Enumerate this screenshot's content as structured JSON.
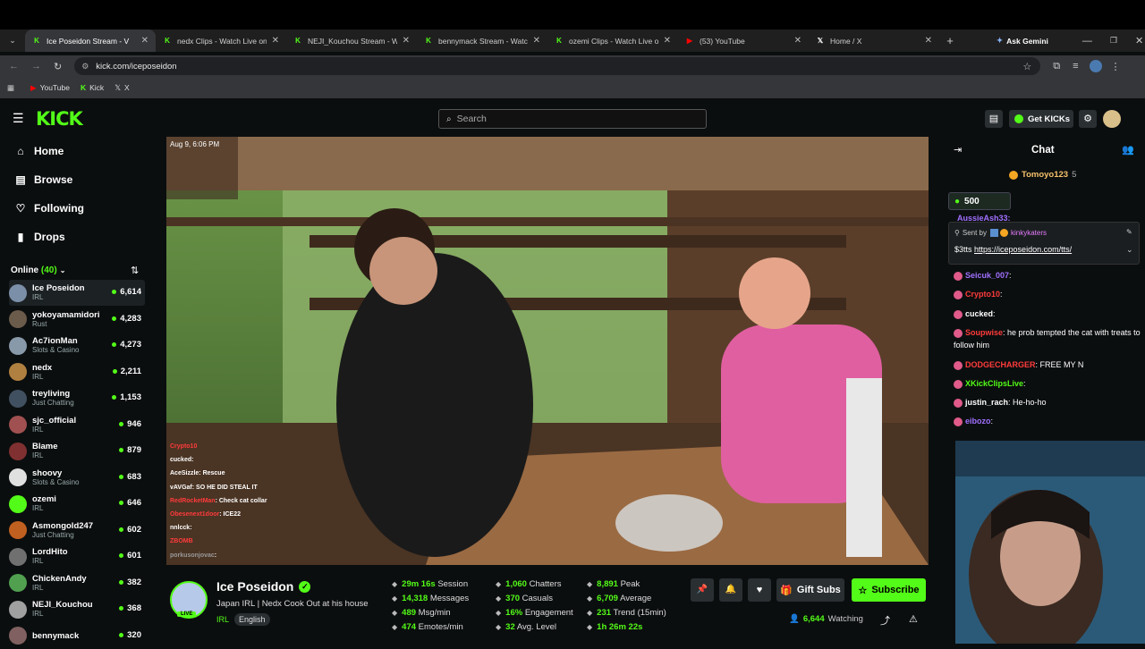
{
  "browser": {
    "tabs": [
      {
        "title": "Ice Poseidon Stream - V",
        "active": true,
        "icon": "kick-icon"
      },
      {
        "title": "nedx Clips - Watch Live on",
        "active": false,
        "icon": "kick-icon"
      },
      {
        "title": "NEJI_Kouchou Stream - Wat",
        "active": false,
        "icon": "kick-icon"
      },
      {
        "title": "bennymack Stream - Watch",
        "active": false,
        "icon": "kick-icon"
      },
      {
        "title": "ozemi Clips - Watch Live on",
        "active": false,
        "icon": "kick-icon"
      },
      {
        "title": "(53) YouTube",
        "active": false,
        "icon": "youtube-icon"
      },
      {
        "title": "Home / X",
        "active": false,
        "icon": "x-icon"
      }
    ],
    "ask_gemini": "Ask Gemini",
    "url": "kick.com/iceposeidon",
    "bookmarks": [
      "YouTube",
      "Kick",
      "X"
    ]
  },
  "header": {
    "logo": "KICK",
    "search_placeholder": "Search",
    "get_kicks": "Get KICKs"
  },
  "sidebar": {
    "nav": [
      {
        "label": "Home",
        "icon": "home-icon"
      },
      {
        "label": "Browse",
        "icon": "browse-icon"
      },
      {
        "label": "Following",
        "icon": "heart-icon"
      },
      {
        "label": "Drops",
        "icon": "drops-icon"
      }
    ],
    "online_label": "Online",
    "online_count": "(40)",
    "channels": [
      {
        "name": "Ice Poseidon",
        "category": "IRL",
        "viewers": "6,614",
        "color": "#7b8fa8"
      },
      {
        "name": "yokoyamamidori",
        "category": "Rust",
        "viewers": "4,283",
        "color": "#6b5b4b"
      },
      {
        "name": "Ac7ionMan",
        "category": "Slots & Casino",
        "viewers": "4,273",
        "color": "#8899aa"
      },
      {
        "name": "nedx",
        "category": "IRL",
        "viewers": "2,211",
        "color": "#b08040"
      },
      {
        "name": "treyliving",
        "category": "Just Chatting",
        "viewers": "1,153",
        "color": "#405060"
      },
      {
        "name": "sjc_official",
        "category": "IRL",
        "viewers": "946",
        "color": "#a05050"
      },
      {
        "name": "Blame",
        "category": "IRL",
        "viewers": "879",
        "color": "#803030"
      },
      {
        "name": "shoovy",
        "category": "Slots & Casino",
        "viewers": "683",
        "color": "#e0e0e0"
      },
      {
        "name": "ozemi",
        "category": "IRL",
        "viewers": "646",
        "color": "#53fc18"
      },
      {
        "name": "Asmongold247",
        "category": "Just Chatting",
        "viewers": "602",
        "color": "#c06020"
      },
      {
        "name": "LordHito",
        "category": "IRL",
        "viewers": "601",
        "color": "#707070"
      },
      {
        "name": "ChickenAndy",
        "category": "IRL",
        "viewers": "382",
        "color": "#50a050"
      },
      {
        "name": "NEJI_Kouchou",
        "category": "IRL",
        "viewers": "368",
        "color": "#a0a0a0"
      },
      {
        "name": "bennymack",
        "category": "",
        "viewers": "320",
        "color": "#806060"
      }
    ]
  },
  "video": {
    "timestamp": "Aug 9, 6:06 PM",
    "overlay_chat": [
      {
        "user": "Crypto10",
        "text": "",
        "color": "#ff3b3b"
      },
      {
        "user": "cucked",
        "text": ":",
        "color": "#ffffff"
      },
      {
        "user": "AceSizzle",
        "text": ": Rescue",
        "color": "#ffffff"
      },
      {
        "user": "vAVGaf",
        "text": ": SO HE DID STEAL IT",
        "color": "#ffffff"
      },
      {
        "user": "RedRocketMan",
        "text": ": Check cat collar",
        "color": "#ff3b3b"
      },
      {
        "user": "Obesenext1door",
        "text": ": ICE22",
        "color": "#ff3b3b"
      },
      {
        "user": "nnlcck",
        "text": ":",
        "color": "#ffffff"
      },
      {
        "user": "ZBOMB",
        "text": "",
        "color": "#ff3b3b"
      },
      {
        "user": "porkusonjovac",
        "text": ":",
        "color": "#999999"
      }
    ]
  },
  "stream": {
    "name": "Ice Poseidon",
    "title": "Japan IRL | Nedx Cook Out at his house",
    "category": "IRL",
    "language": "English",
    "live_badge": "LIVE",
    "stats": [
      {
        "value": "29m 16s",
        "label": "Session"
      },
      {
        "value": "14,318",
        "label": "Messages"
      },
      {
        "value": "489",
        "label": "Msg/min"
      },
      {
        "value": "474",
        "label": "Emotes/min"
      },
      {
        "value": "1,060",
        "label": "Chatters"
      },
      {
        "value": "370",
        "label": "Casuals"
      },
      {
        "value": "16%",
        "label": "Engagement"
      },
      {
        "value": "32",
        "label": "Avg. Level"
      },
      {
        "value": "8,891",
        "label": "Peak"
      },
      {
        "value": "6,709",
        "label": "Average"
      },
      {
        "value": "231",
        "label": "Trend (15min)"
      },
      {
        "value": "1h 26m 22s",
        "label": ""
      }
    ],
    "gift_subs": "Gift Subs",
    "subscribe": "Subscribe",
    "watching_count": "6,644",
    "watching_label": "Watching"
  },
  "chat": {
    "title": "Chat",
    "top_user": "Tomoyo123",
    "top_value": "5",
    "kicks_amount": "500",
    "partial_user": "AussieAsh33:",
    "pinned": {
      "sent_by": "Sent by",
      "sender": "kinkykaters",
      "amount": "$3tts",
      "link": "https://iceposeidon.com/tts/"
    },
    "messages": [
      {
        "user": "Seicuk_007",
        "text": ":",
        "color": "#a070ff"
      },
      {
        "user": "Crypto10",
        "text": ":",
        "color": "#ff3b3b"
      },
      {
        "user": "cucked",
        "text": ":",
        "color": "#ffffff"
      },
      {
        "user": "Soupwise",
        "text": ": he prob tempted the cat with treats to follow him",
        "color": "#ff3b3b"
      },
      {
        "user": "DODGECHARGER",
        "text": ": FREE MY N",
        "color": "#ff3b3b"
      },
      {
        "user": "XKickClipsLive",
        "text": ":",
        "color": "#53fc18"
      },
      {
        "user": "justin_rach",
        "text": ":  He-ho-ho",
        "color": "#ffffff"
      },
      {
        "user": "eibozo",
        "text": ":",
        "color": "#a070ff"
      }
    ]
  },
  "colors": {
    "brand": "#53fc18",
    "bg": "#0b0e0f"
  }
}
